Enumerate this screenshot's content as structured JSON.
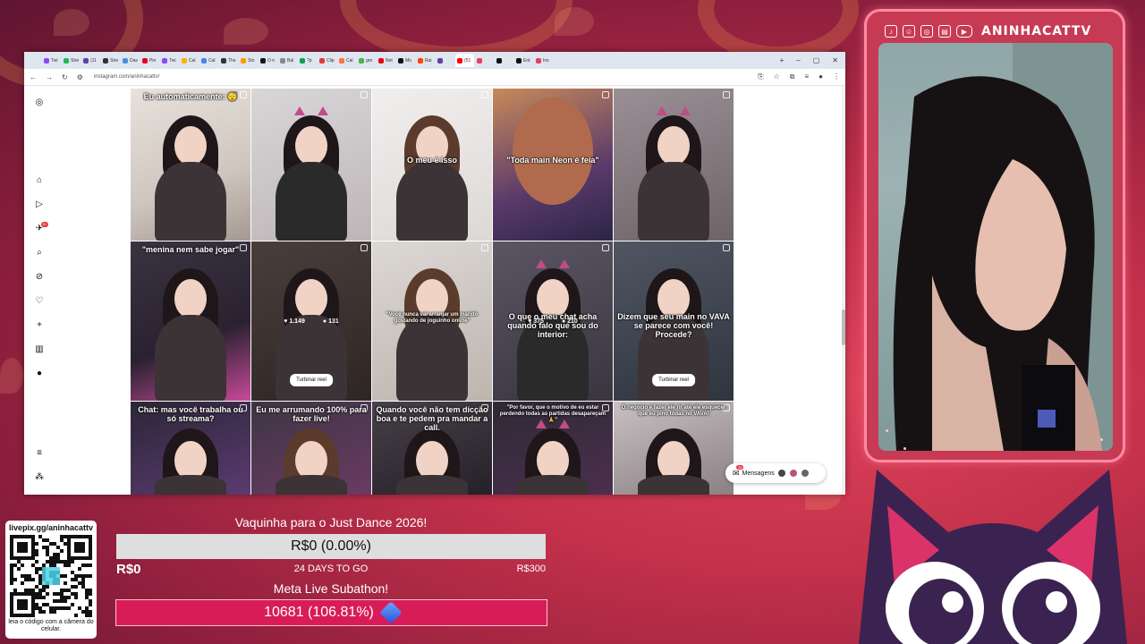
{
  "browser": {
    "tabs": [
      "Twi",
      "Stre",
      "(11",
      "Stre",
      "Das",
      "Pin",
      "Twi",
      "Cal",
      "Cal",
      "The",
      "Sto",
      "O n",
      "Bal",
      "?p",
      "Clip",
      "Cal",
      "gre",
      "Net",
      "Mo",
      "Rai",
      "",
      "(51",
      "",
      "",
      "Ent",
      "Ins"
    ],
    "active_tab_index": 21,
    "url": "instagram.com/aninhacattv/",
    "new_tab": "+",
    "win_minimize": "–",
    "win_restore": "▢",
    "win_close": "✕"
  },
  "instagram": {
    "notification_count": "9+",
    "posts": [
      {
        "caption": "Eu automaticamente: 😴",
        "caption_pos": "top"
      },
      {
        "caption": "",
        "caption_pos": "none"
      },
      {
        "caption": "O meu é isso",
        "caption_pos": "mid"
      },
      {
        "caption": "\"Toda main Neon é feia\"",
        "caption_pos": "mid"
      },
      {
        "caption": "",
        "caption_pos": "none"
      },
      {
        "caption": "\"menina nem sabe jogar\"",
        "caption_pos": "top"
      },
      {
        "caption": "",
        "caption_pos": "none",
        "likes": "1.149",
        "comments": "131",
        "button": "Turbinar reel"
      },
      {
        "caption": "\"Você nunca vai arranjar um marido gostando de joguinho online\"",
        "caption_pos": "mid"
      },
      {
        "caption": "O que o meu chat acha quando falo que sou do interior:",
        "caption_pos": "mid",
        "likes": "375",
        "comments": "210"
      },
      {
        "caption": "Dizem que seu main no VAVA se parece com você! Procede?",
        "caption_pos": "mid",
        "button": "Turbinar reel"
      },
      {
        "caption": "Chat: mas você trabalha ou só streama?",
        "caption_pos": "top"
      },
      {
        "caption": "Eu me arrumando 100% para fazer live!",
        "caption_pos": "top"
      },
      {
        "caption": "Quando você não tem dicção boa e te pedem pra mandar a call.",
        "caption_pos": "top"
      },
      {
        "caption": "\"Por favor, que o motivo de eu estar perdendo todas as partidas desapareçam 🙏\"",
        "caption_pos": "top"
      },
      {
        "caption": "O negócio é fazer ele rir até ele esquecer que eu pino todas no VAVA!",
        "caption_pos": "top"
      }
    ],
    "messages_label": "Mensagens",
    "messages_badge": "26"
  },
  "webcam": {
    "channel_name": "ANINHACATTV",
    "social_icons": [
      "tiktok-icon",
      "discord-icon",
      "instagram-icon",
      "twitch-icon",
      "youtube-icon"
    ]
  },
  "qr": {
    "title": "livepix.gg/aninhacattv",
    "caption": "leia o código com a câmera do celular."
  },
  "goal1": {
    "title": "Vaquinha para o Just Dance 2026!",
    "bar_text": "R$0 (0.00%)",
    "progress": 0.0,
    "min": "R$0",
    "days_left": "24 DAYS TO GO",
    "max": "R$300"
  },
  "goal2": {
    "title": "Meta Live Subathon!",
    "bar_text": "10681 (106.81%)",
    "progress": 1.0681
  }
}
